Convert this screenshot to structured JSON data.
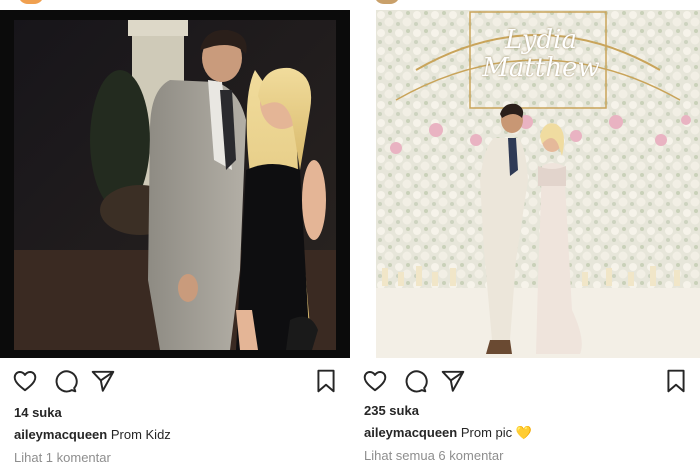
{
  "posts": [
    {
      "likes": "14 suka",
      "username": "aileymacqueen",
      "caption": "Prom Kidz",
      "comments_link": "Lihat 1 komentar"
    },
    {
      "likes": "235 suka",
      "username": "aileymacqueen",
      "caption": "Prom pic",
      "caption_emoji": "💛",
      "comments_link": "Lihat semua 6 komentar",
      "sign_text": "Lydia Matthew"
    }
  ],
  "icons": {
    "like": "heart-icon",
    "comment": "comment-icon",
    "share": "paper-plane-icon",
    "save": "bookmark-icon"
  },
  "colors": {
    "text": "#262626",
    "muted": "#8e8e8e",
    "emoji_heart": "#f7c948"
  }
}
